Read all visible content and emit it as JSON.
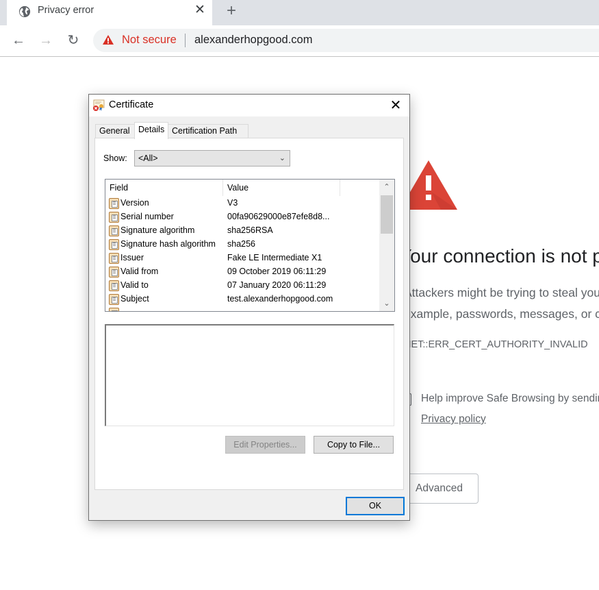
{
  "browser": {
    "tab": {
      "title": "Privacy error",
      "icon": "globe-icon",
      "close_glyph": "✕"
    },
    "new_tab_glyph": "+",
    "nav": {
      "back_glyph": "←",
      "forward_glyph": "→",
      "reload_glyph": "↻"
    },
    "omnibox": {
      "security_label": "Not secure",
      "url": "alexanderhopgood.com",
      "security_color": "#d93025"
    }
  },
  "page": {
    "heading": "Your connection is not private",
    "paragraph_line1": "Attackers might be trying to steal your information from alexanderhopgood.com (for",
    "paragraph_line2": "example, passwords, messages, or credit cards).",
    "error_code": "NET::ERR_CERT_AUTHORITY_INVALID",
    "safe_browsing_text": "Help improve Safe Browsing by sending some system information and page content to Google.",
    "privacy_link": "Privacy policy",
    "advanced_button": "Advanced",
    "warning_color": "#db4437"
  },
  "dialog": {
    "title": "Certificate",
    "close_glyph": "✕",
    "tabs": [
      {
        "label": "General",
        "active": false
      },
      {
        "label": "Details",
        "active": true
      },
      {
        "label": "Certification Path",
        "active": false
      }
    ],
    "show": {
      "label": "Show:",
      "selected": "<All>"
    },
    "list": {
      "columns": [
        "Field",
        "Value"
      ],
      "rows": [
        {
          "field": "Version",
          "value": "V3"
        },
        {
          "field": "Serial number",
          "value": "00fa90629000e87efe8d8..."
        },
        {
          "field": "Signature algorithm",
          "value": "sha256RSA"
        },
        {
          "field": "Signature hash algorithm",
          "value": "sha256"
        },
        {
          "field": "Issuer",
          "value": "Fake LE Intermediate X1"
        },
        {
          "field": "Valid from",
          "value": "09 October 2019 06:11:29"
        },
        {
          "field": "Valid to",
          "value": "07 January 2020 06:11:29"
        },
        {
          "field": "Subject",
          "value": "test.alexanderhopgood.com"
        }
      ]
    },
    "detail_text": "",
    "buttons": {
      "edit_properties": "Edit Properties...",
      "copy_to_file": "Copy to File...",
      "ok": "OK"
    }
  }
}
